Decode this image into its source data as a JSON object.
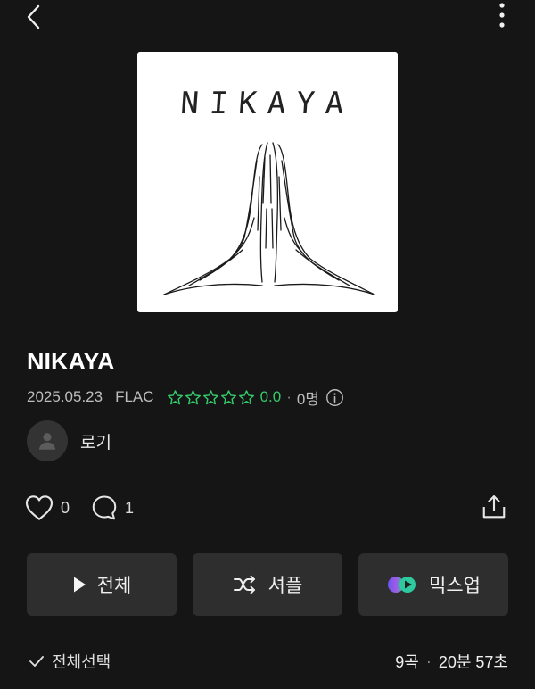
{
  "album": {
    "title": "NIKAYA",
    "cover_text": "NIKAYA",
    "release_date": "2025.05.23",
    "format": "FLAC",
    "rating": "0.0",
    "rating_count": "0명",
    "star_count": 5
  },
  "artist": {
    "name": "로기"
  },
  "social": {
    "likes": "0",
    "comments": "1"
  },
  "actions": {
    "play_all": "전체",
    "shuffle": "셔플",
    "mixup": "믹스업"
  },
  "list": {
    "select_all": "전체선택",
    "track_count": "9곡",
    "duration": "20분 57초"
  },
  "colors": {
    "background": "#151515",
    "button_bg": "#2e2e2e",
    "rating_green": "#34c96a"
  },
  "icons": [
    "back-arrow-icon",
    "more-vertical-icon",
    "star-outline-icon",
    "info-icon",
    "person-icon",
    "heart-icon",
    "comment-icon",
    "share-icon",
    "play-icon",
    "shuffle-icon",
    "mixup-icon",
    "check-icon"
  ]
}
